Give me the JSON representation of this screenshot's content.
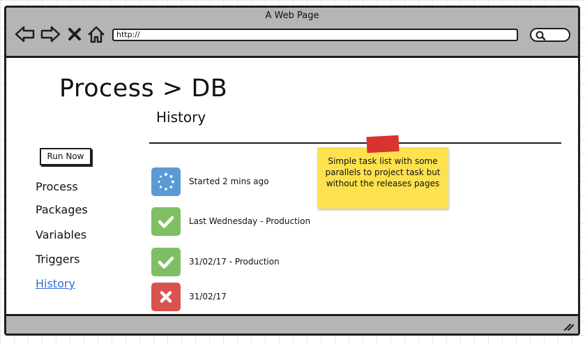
{
  "window": {
    "title": "A Web Page"
  },
  "browser": {
    "url": "http://"
  },
  "page": {
    "title": "Process > DB",
    "section_title": "History"
  },
  "actions": {
    "run_now": "Run Now"
  },
  "nav": {
    "items": [
      {
        "label": "Process",
        "active": false
      },
      {
        "label": "Packages",
        "active": false
      },
      {
        "label": "Variables",
        "active": false
      },
      {
        "label": "Triggers",
        "active": false
      },
      {
        "label": "History",
        "active": true
      }
    ]
  },
  "history": {
    "items": [
      {
        "status": "running",
        "icon": "spinner-icon",
        "color": "#5b9bd5",
        "text": "Started 2 mins ago"
      },
      {
        "status": "success",
        "icon": "check-icon",
        "color": "#7fbf63",
        "text": "Last Wednesday - Production"
      },
      {
        "status": "success",
        "icon": "check-icon",
        "color": "#7fbf63",
        "text": "31/02/17 - Production"
      },
      {
        "status": "failed",
        "icon": "cross-icon",
        "color": "#d9534f",
        "text": "31/02/17"
      }
    ]
  },
  "sticky_note": {
    "text": "Simple task list with some parallels to project task but without the releases pages",
    "color": "#fde24f",
    "tape_color": "#d9332e"
  }
}
